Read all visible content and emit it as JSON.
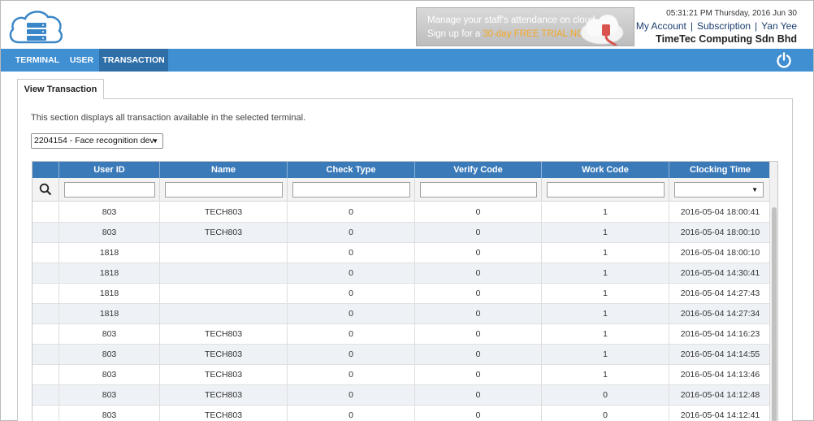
{
  "header": {
    "datetime": "05:31:21 PM Thursday, 2016 Jun 30",
    "my_account": "My Account",
    "subscription": "Subscription",
    "user": "Yan Yee",
    "company": "TimeTec Computing Sdn Bhd",
    "separator": "|"
  },
  "banner": {
    "line1": "Manage your staff's attendance on cloud",
    "line2_prefix": "Sign up for a ",
    "line2_highlight": "30-day FREE TRIAL NOW!"
  },
  "nav": {
    "items": [
      {
        "label": "TERMINAL"
      },
      {
        "label": "USER"
      },
      {
        "label": "TRANSACTION",
        "active": true
      }
    ],
    "power_icon": "power-icon"
  },
  "page": {
    "tab_label": "View Transaction",
    "description": "This section displays all transaction available in the selected terminal.",
    "terminal_selected": "2204154 - Face recognition dev"
  },
  "table": {
    "columns": [
      "User ID",
      "Name",
      "Check Type",
      "Verify Code",
      "Work Code",
      "Clocking Time"
    ],
    "rows": [
      [
        "803",
        "TECH803",
        "0",
        "0",
        "1",
        "2016-05-04 18:00:41"
      ],
      [
        "803",
        "TECH803",
        "0",
        "0",
        "1",
        "2016-05-04 18:00:10"
      ],
      [
        "1818",
        "",
        "0",
        "0",
        "1",
        "2016-05-04 18:00:10"
      ],
      [
        "1818",
        "",
        "0",
        "0",
        "1",
        "2016-05-04 14:30:41"
      ],
      [
        "1818",
        "",
        "0",
        "0",
        "1",
        "2016-05-04 14:27:43"
      ],
      [
        "1818",
        "",
        "0",
        "0",
        "1",
        "2016-05-04 14:27:34"
      ],
      [
        "803",
        "TECH803",
        "0",
        "0",
        "1",
        "2016-05-04 14:16:23"
      ],
      [
        "803",
        "TECH803",
        "0",
        "0",
        "1",
        "2016-05-04 14:14:55"
      ],
      [
        "803",
        "TECH803",
        "0",
        "0",
        "1",
        "2016-05-04 14:13:46"
      ],
      [
        "803",
        "TECH803",
        "0",
        "0",
        "0",
        "2016-05-04 14:12:48"
      ],
      [
        "803",
        "TECH803",
        "0",
        "0",
        "0",
        "2016-05-04 14:12:41"
      ]
    ]
  },
  "colors": {
    "navbar": "#3f8fd2",
    "nav_active": "#2f6fa8",
    "table_header": "#3a7ab9",
    "row_alt": "#eef2f6"
  }
}
